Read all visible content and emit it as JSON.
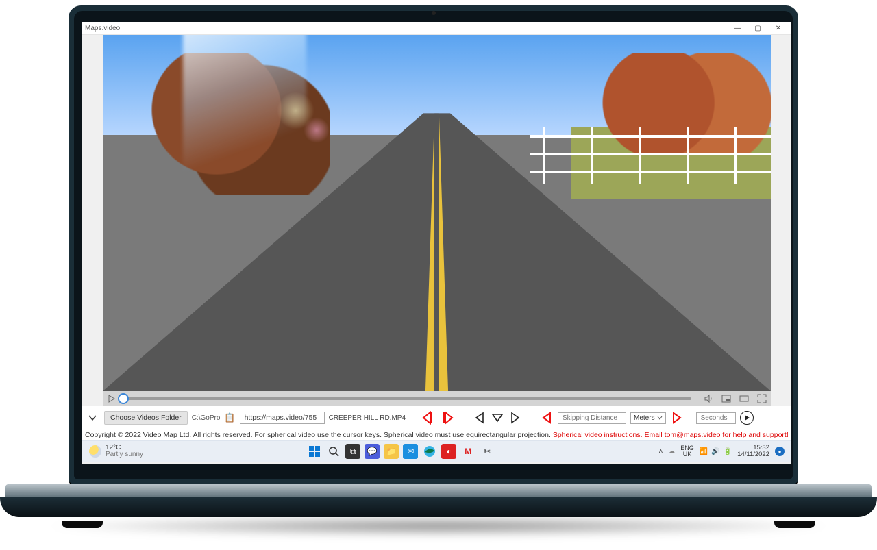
{
  "window": {
    "title": "Maps.video"
  },
  "controls": {
    "choose_folder": "Choose Videos Folder",
    "folder_path": "C:\\GoPro",
    "url_value": "https://maps.video/755",
    "current_file": "CREEPER HILL RD.MP4",
    "skip_placeholder": "Skipping Distance",
    "unit_label": "Meters",
    "seconds_placeholder": "Seconds"
  },
  "footer": {
    "copyright": "Copyright © 2022 Video Map Ltd. All rights reserved. For spherical video use the cursor keys. Spherical video must use equirectangular projection. ",
    "link1": "Spherical video instructions.",
    "link2": "Email tom@maps.video for help and support!"
  },
  "taskbar": {
    "temp": "12°C",
    "weather": "Partly sunny",
    "lang1": "ENG",
    "lang2": "UK",
    "time": "15:32",
    "date": "14/11/2022"
  }
}
